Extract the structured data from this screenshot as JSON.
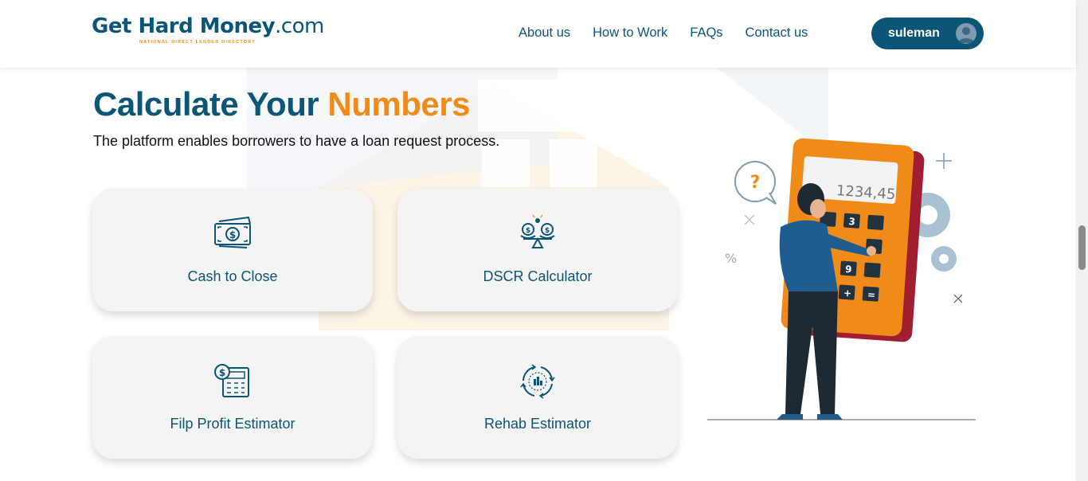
{
  "header": {
    "logo": {
      "brand_main": "Get Hard Money",
      "brand_suffix": ".com",
      "tagline": "NATIONAL DIRECT LENDER DIRECTORY"
    },
    "nav": [
      {
        "label": "About us"
      },
      {
        "label": "How to Work"
      },
      {
        "label": "FAQs"
      },
      {
        "label": "Contact us"
      }
    ],
    "user": {
      "name": "suleman",
      "icon": "user-avatar-icon"
    }
  },
  "hero": {
    "title_part1": "Calculate Your",
    "title_part2": "Numbers",
    "subtitle": "The platform enables borrowers to have a loan request process."
  },
  "cards": [
    {
      "label": "Cash to Close",
      "icon": "cash-money-icon"
    },
    {
      "label": "DSCR Calculator",
      "icon": "balance-scale-coins-icon"
    },
    {
      "label": "Filp Profit Estimator",
      "icon": "calculator-dollar-icon"
    },
    {
      "label": "Rehab Estimator",
      "icon": "cycle-chart-icon"
    }
  ],
  "illustration": {
    "calculator_display": "1234,45",
    "speech_bubble": "?",
    "keys": [
      "3",
      "9",
      "+",
      "="
    ]
  },
  "colors": {
    "primary": "#0b5577",
    "accent": "#f08b1a",
    "card_bg": "#f4f4f4"
  }
}
